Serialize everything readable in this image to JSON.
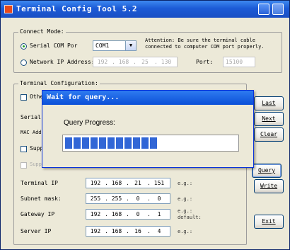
{
  "window": {
    "title": "Terminal Config Tool 5.2"
  },
  "connect_mode": {
    "legend": "Connect Mode:",
    "serial_label": "Serial COM Por",
    "serial_selected": true,
    "com_value": "COM1",
    "attention_line1": "Attention: Be sure the terminal cable",
    "attention_line2": "connected to computer COM port properly.",
    "network_label": "Network IP Address:",
    "network_ip": [
      "192",
      "168",
      "25",
      "130"
    ],
    "port_label": "Port:",
    "port_value": "15100"
  },
  "terminal_config": {
    "legend": "Terminal Configuration:",
    "other_label": "Other",
    "serial_label": "Serial",
    "mac_label": "MAC Addr",
    "support1_label": "Suppo",
    "support2_label": "Suppo",
    "rows": [
      {
        "label": "Terminal IP",
        "ip": [
          "192",
          "168",
          "21",
          "151"
        ],
        "hint": "e.g.:"
      },
      {
        "label": "Subnet mask:",
        "ip": [
          "255",
          "255",
          "0",
          "0"
        ],
        "hint": "e.g.:"
      },
      {
        "label": "Gateway IP",
        "ip": [
          "192",
          "168",
          "0",
          "1"
        ],
        "hint": "e.g.:",
        "hint2": "default:"
      },
      {
        "label": "Server IP",
        "ip": [
          "192",
          "168",
          "16",
          "4"
        ],
        "hint": "e.g.:"
      }
    ]
  },
  "buttons": {
    "last": "Last",
    "next": "Next",
    "clear": "Clear",
    "query": "Query",
    "write": "Write",
    "exit": "Exit"
  },
  "dialog": {
    "title": "Wait for query...",
    "label": "Query Progress:",
    "progress": 0.44,
    "segments_total": 25
  },
  "colors": {
    "progress": "#3166d6",
    "titlebar": "#1c5bd6"
  }
}
